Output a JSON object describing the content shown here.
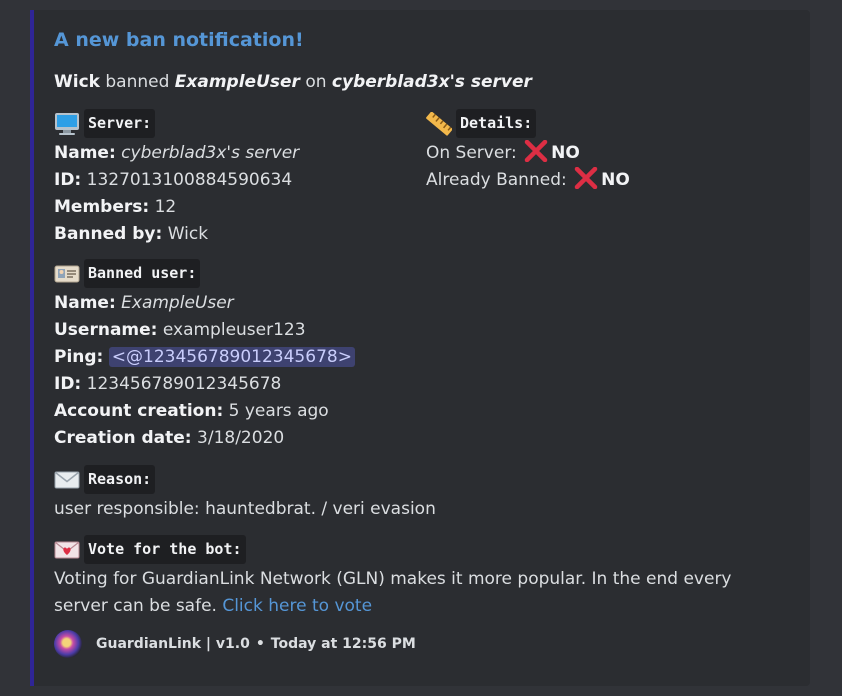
{
  "embed": {
    "title": "A new ban notification!",
    "description": {
      "actor": "Wick",
      "action": " banned ",
      "target": "ExampleUser",
      "on": " on ",
      "server": "cyberblad3x's server"
    },
    "colors": {
      "accent_bar": "#2f2596",
      "title": "#5596d6",
      "embed_bg": "#2b2d31",
      "page_bg": "#313338"
    }
  },
  "server_field": {
    "icon": "computer-icon",
    "title": "Server:",
    "name_label": "Name:",
    "name_value": "cyberblad3x's server",
    "id_label": "ID:",
    "id_value": "1327013100884590634",
    "members_label": "Members:",
    "members_value": "12",
    "banned_by_label": "Banned by:",
    "banned_by_value": "Wick"
  },
  "details_field": {
    "icon": "ruler-icon",
    "title": "Details:",
    "on_server_label": "On Server:",
    "on_server_value": "NO",
    "already_banned_label": "Already Banned:",
    "already_banned_value": "NO"
  },
  "banned_user_field": {
    "icon": "id-card-icon",
    "title": "Banned user:",
    "name_label": "Name:",
    "name_value": "ExampleUser",
    "username_label": "Username:",
    "username_value": "exampleuser123",
    "ping_label": "Ping:",
    "ping_value": "<@123456789012345678>",
    "id_label": "ID:",
    "id_value": "123456789012345678",
    "account_creation_label": "Account creation:",
    "account_creation_value": "5 years ago",
    "creation_date_label": "Creation date:",
    "creation_date_value": "3/18/2020"
  },
  "reason_field": {
    "icon": "envelope-icon",
    "title": "Reason:",
    "text": "user responsible: hauntedbrat. / veri evasion"
  },
  "vote_field": {
    "icon": "love-letter-icon",
    "title": "Vote for the bot:",
    "text_line1": "Voting for GuardianLink Network (GLN) makes it more popular. In the end every",
    "text_line2": "server can be safe. ",
    "link_text": "Click here to vote"
  },
  "footer": {
    "text": "GuardianLink | v1.0",
    "separator": "•",
    "timestamp": "Today at 12:56 PM"
  }
}
